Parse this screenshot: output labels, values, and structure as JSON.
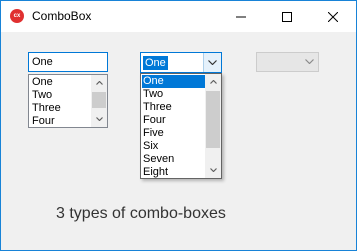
{
  "window": {
    "title": "ComboBox",
    "app_icon_text": "cx"
  },
  "combo_simple": {
    "value": "One",
    "items": [
      "One",
      "Two",
      "Three",
      "Four"
    ]
  },
  "combo_dropdown": {
    "selected": "One",
    "items": [
      "One",
      "Two",
      "Three",
      "Four",
      "Five",
      "Six",
      "Seven",
      "Eight"
    ]
  },
  "combo_disabled": {
    "value": ""
  },
  "caption": "3 types of combo-boxes",
  "colors": {
    "accent": "#0078d7",
    "window_border": "#1883d7",
    "app_icon": "#e03030"
  },
  "icons": {
    "minimize": "minimize-icon",
    "maximize": "maximize-icon",
    "close": "close-icon"
  }
}
